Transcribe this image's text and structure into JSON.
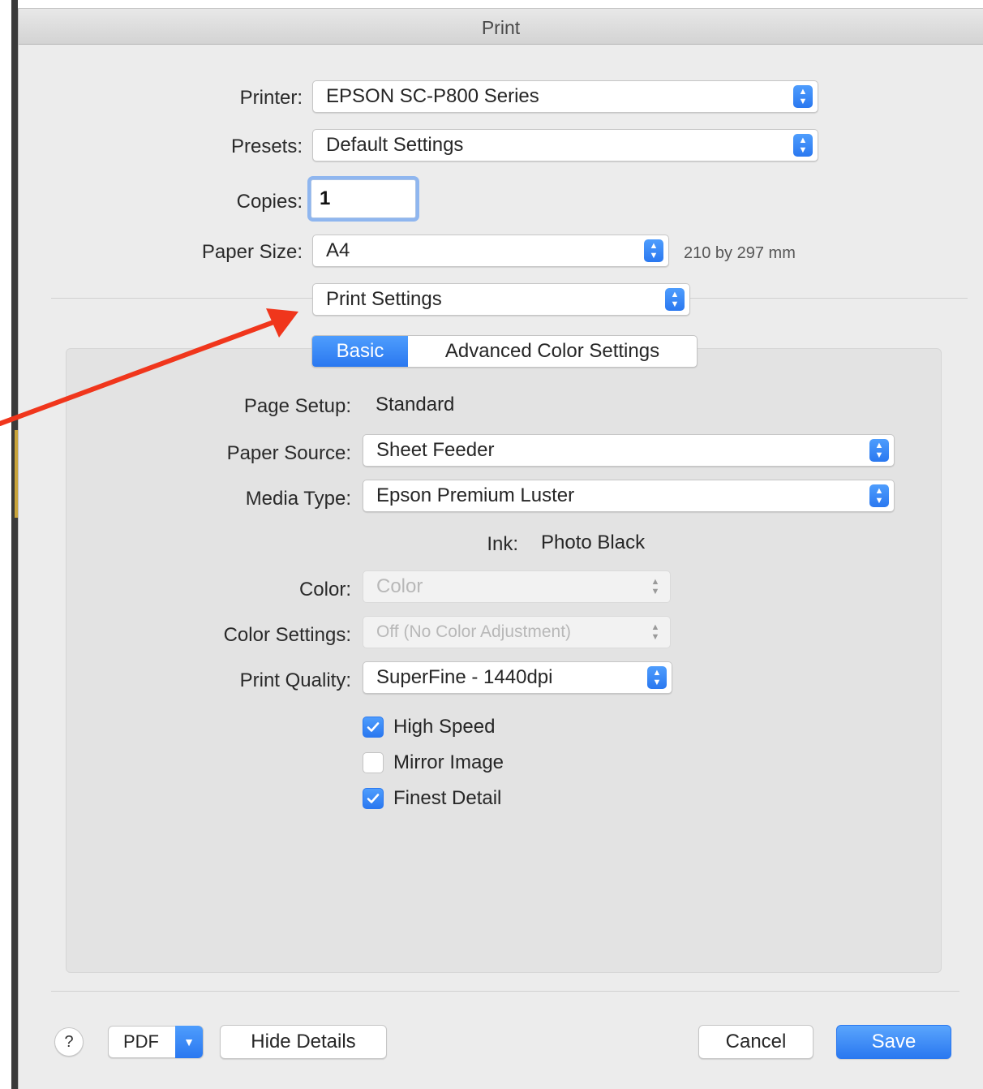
{
  "window": {
    "title": "Print"
  },
  "form": {
    "printer": {
      "label": "Printer:",
      "value": "EPSON SC-P800 Series"
    },
    "presets": {
      "label": "Presets:",
      "value": "Default Settings"
    },
    "copies": {
      "label": "Copies:",
      "value": "1"
    },
    "paper_size": {
      "label": "Paper Size:",
      "value": "A4",
      "dimensions": "210 by 297 mm"
    },
    "section_popup": {
      "value": "Print Settings"
    }
  },
  "tabs": [
    {
      "label": "Basic",
      "selected": true
    },
    {
      "label": "Advanced Color Settings",
      "selected": false
    }
  ],
  "basic": {
    "page_setup": {
      "label": "Page Setup:",
      "value": "Standard"
    },
    "paper_source": {
      "label": "Paper Source:",
      "value": "Sheet Feeder"
    },
    "media_type": {
      "label": "Media Type:",
      "value": "Epson Premium Luster"
    },
    "ink": {
      "label": "Ink:",
      "value": "Photo Black"
    },
    "color": {
      "label": "Color:",
      "value": "Color",
      "enabled": false
    },
    "color_settings": {
      "label": "Color Settings:",
      "value": "Off (No Color Adjustment)",
      "enabled": false
    },
    "print_quality": {
      "label": "Print Quality:",
      "value": "SuperFine - 1440dpi"
    },
    "checkboxes": [
      {
        "label": "High Speed",
        "checked": true
      },
      {
        "label": "Mirror Image",
        "checked": false
      },
      {
        "label": "Finest Detail",
        "checked": true
      }
    ]
  },
  "footer": {
    "help_label": "?",
    "pdf_label": "PDF",
    "hide_details_label": "Hide Details",
    "cancel_label": "Cancel",
    "save_label": "Save"
  },
  "colors": {
    "accent": "#2a78f0",
    "annotation_arrow": "#f0361c",
    "window_bg": "#ececec"
  },
  "icons": {
    "popup_stepper": "up-down-chevron-icon",
    "checkbox_mark": "checkmark-icon",
    "pdf_dropdown": "chevron-down-icon"
  }
}
